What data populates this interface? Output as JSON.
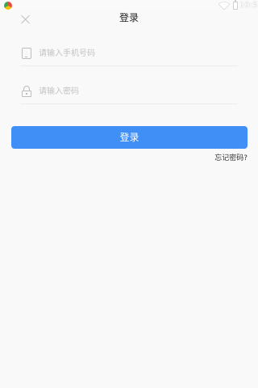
{
  "status_bar": {
    "time": "10:57",
    "icons": [
      "app-icon",
      "wifi-icon",
      "battery-icon"
    ]
  },
  "header": {
    "title": "登录",
    "close_icon": "close-icon"
  },
  "form": {
    "phone": {
      "icon": "phone-icon",
      "value": "",
      "placeholder": "请输入手机号码"
    },
    "password": {
      "icon": "lock-icon",
      "value": "",
      "placeholder": "请输入密码"
    },
    "submit_label": "登录",
    "forgot_label": "忘记密码?"
  },
  "colors": {
    "background": "#f9f9f9",
    "primary": "#3f8ff6",
    "divider": "#ececec",
    "placeholder": "#c3c3c3",
    "icon": "#bdbdbd"
  }
}
